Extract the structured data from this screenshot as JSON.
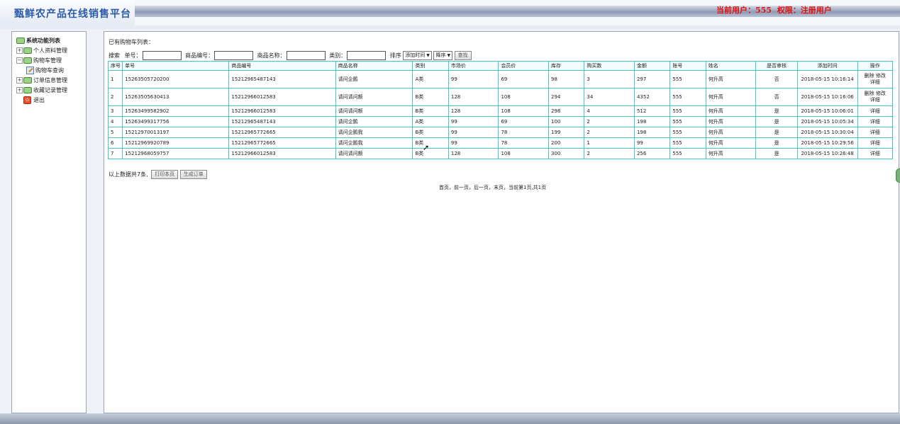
{
  "header": {
    "title": "甄鲜农产品在线销售平台",
    "user_label": "当前用户：555",
    "role_label": "权限：注册用户"
  },
  "sidebar": {
    "root": "系统功能列表",
    "items": [
      {
        "label": "个人资料管理",
        "expandable": true
      },
      {
        "label": "购物车管理",
        "expandable": true
      },
      {
        "label": "购物车查询",
        "expandable": false,
        "child": true
      },
      {
        "label": "订单信息管理",
        "expandable": true
      },
      {
        "label": "收藏记录管理",
        "expandable": true
      },
      {
        "label": "退出",
        "expandable": false,
        "exit": true
      }
    ]
  },
  "main": {
    "caption": "已有购物车列表：",
    "search": {
      "label": "搜索",
      "order_no_label": "单号：",
      "product_no_label": "商品编号：",
      "product_name_label": "商品名称：",
      "category_label": "类别：",
      "sort_label": "排序",
      "sort_field": "添加时间",
      "sort_order": "降序",
      "search_button": "查找"
    },
    "columns": [
      "序号",
      "单号",
      "商品编号",
      "商品名称",
      "类别",
      "市场价",
      "会员价",
      "库存",
      "购买数",
      "金额",
      "账号",
      "姓名",
      "是否审核",
      "添加时间",
      "操作"
    ],
    "rows": [
      {
        "no": "1",
        "order": "15263505720200",
        "pid": "15212965487143",
        "name": "请问企鹅",
        "cat": "A类",
        "market": "99",
        "member": "69",
        "stock": "98",
        "qty": "3",
        "amount": "297",
        "account": "555",
        "uname": "何升高",
        "audited": "否",
        "time": "2018-05-15 10:16:14",
        "ops": [
          "删除",
          "修改",
          "详细"
        ]
      },
      {
        "no": "2",
        "order": "15263505630413",
        "pid": "15212966012583",
        "name": "请问请问额",
        "cat": "B类",
        "market": "128",
        "member": "108",
        "stock": "294",
        "qty": "34",
        "amount": "4352",
        "account": "555",
        "uname": "何升高",
        "audited": "否",
        "time": "2018-05-15 10:16:06",
        "ops": [
          "删除",
          "修改",
          "详细"
        ]
      },
      {
        "no": "3",
        "order": "15263499582902",
        "pid": "15212966012583",
        "name": "请问请问额",
        "cat": "B类",
        "market": "128",
        "member": "108",
        "stock": "298",
        "qty": "4",
        "amount": "512",
        "account": "555",
        "uname": "何升高",
        "audited": "是",
        "time": "2018-05-15 10:06:01",
        "ops": [
          "详细"
        ]
      },
      {
        "no": "4",
        "order": "15263499317756",
        "pid": "15212965487143",
        "name": "请问企鹅",
        "cat": "A类",
        "market": "99",
        "member": "69",
        "stock": "100",
        "qty": "2",
        "amount": "198",
        "account": "555",
        "uname": "何升高",
        "audited": "是",
        "time": "2018-05-15 10:05:34",
        "ops": [
          "详细"
        ]
      },
      {
        "no": "5",
        "order": "15212970013197",
        "pid": "15212965772665",
        "name": "请问企鹅我",
        "cat": "B类",
        "market": "99",
        "member": "78",
        "stock": "199",
        "qty": "2",
        "amount": "198",
        "account": "555",
        "uname": "何升高",
        "audited": "是",
        "time": "2018-05-15 10:30:04",
        "ops": [
          "详细"
        ]
      },
      {
        "no": "6",
        "order": "15212969920789",
        "pid": "15212965772665",
        "name": "请问企鹅我",
        "cat": "B类",
        "market": "99",
        "member": "78",
        "stock": "200",
        "qty": "1",
        "amount": "99",
        "account": "555",
        "uname": "何升高",
        "audited": "是",
        "time": "2018-05-15 10:29:56",
        "ops": [
          "详细"
        ]
      },
      {
        "no": "7",
        "order": "15212968059757",
        "pid": "15212966012583",
        "name": "请问请问额",
        "cat": "B类",
        "market": "128",
        "member": "108",
        "stock": "300",
        "qty": "2",
        "amount": "256",
        "account": "555",
        "uname": "何升高",
        "audited": "是",
        "time": "2018-05-15 10:26:48",
        "ops": [
          "详细"
        ]
      }
    ],
    "summary": "以上数据共7条,",
    "print_button": "打印本页",
    "generate_button": "生成订单",
    "pager": "首页，前一页，后一页，末页，当前第1页,共1页"
  }
}
